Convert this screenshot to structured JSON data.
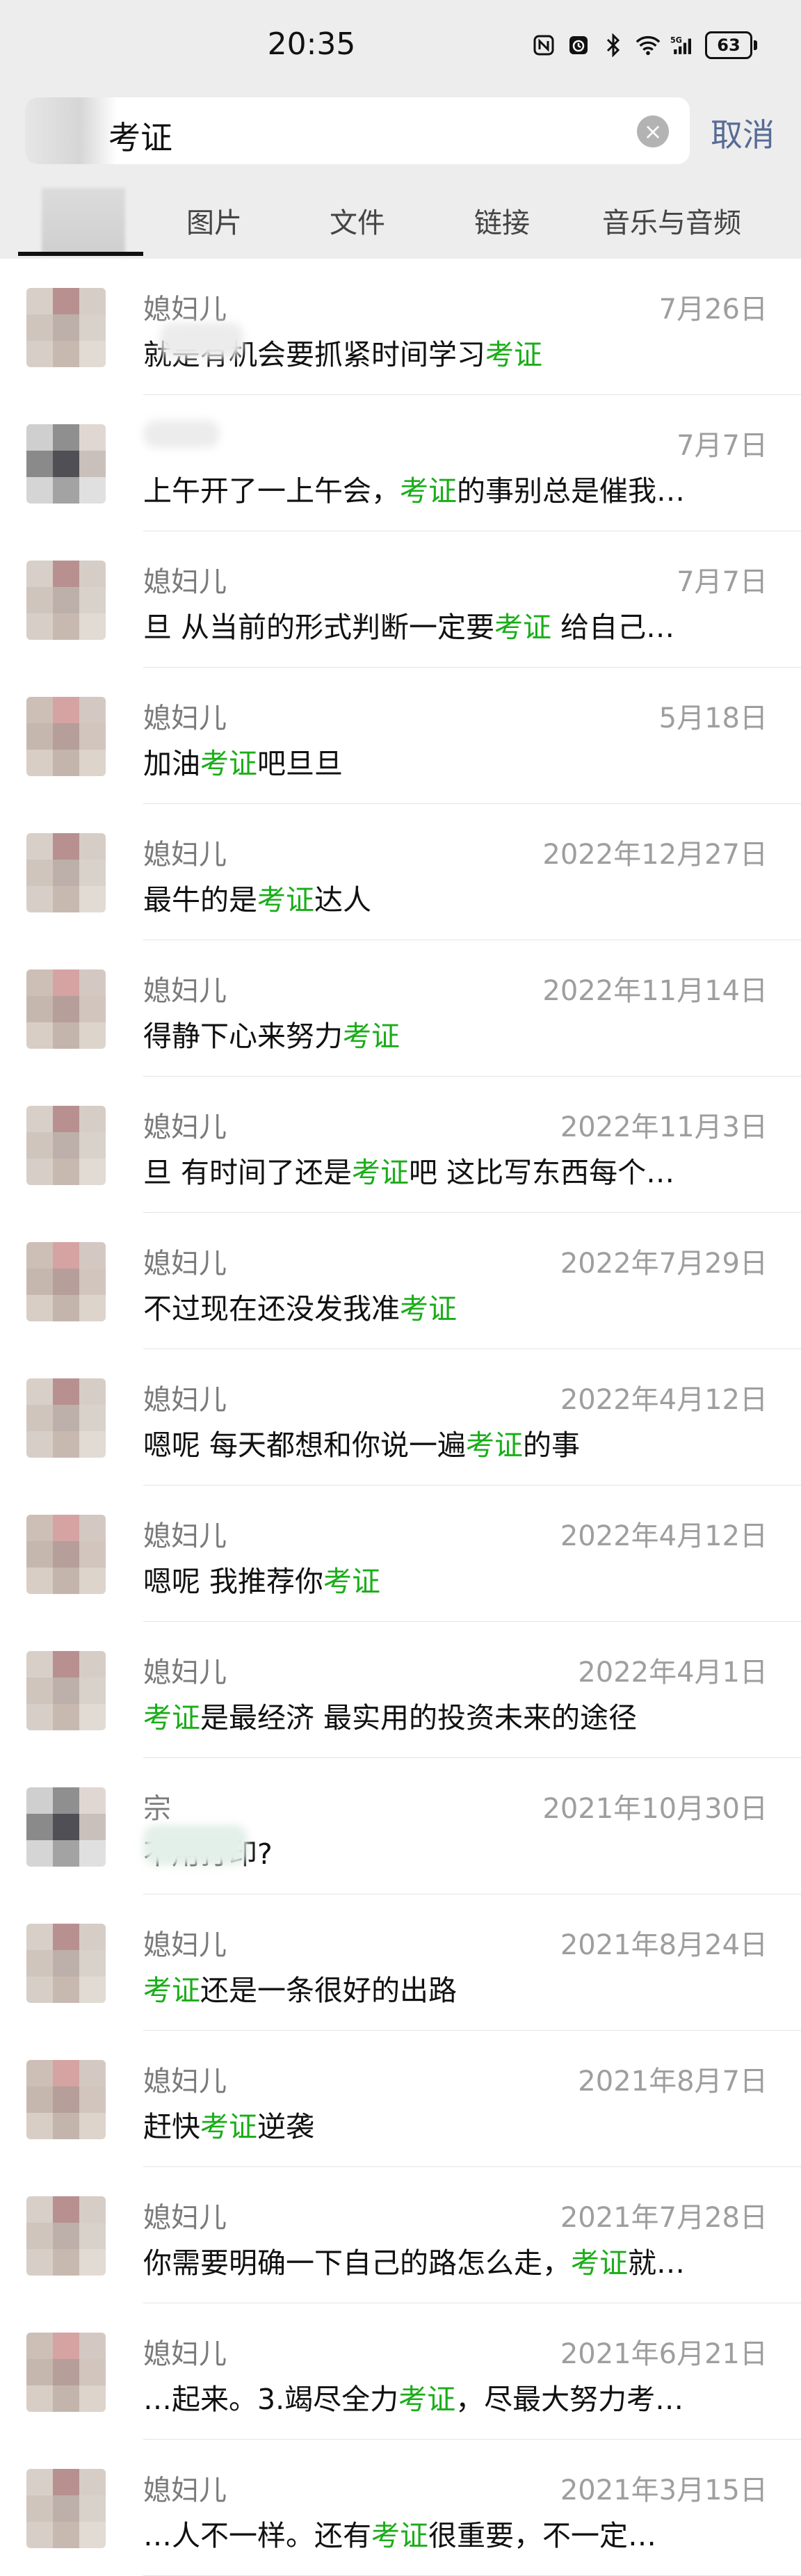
{
  "status_bar": {
    "time": "20:35",
    "battery": "63"
  },
  "search": {
    "query": "考证",
    "cancel_label": "取消"
  },
  "tabs": [
    {
      "label": "图片"
    },
    {
      "label": "文件"
    },
    {
      "label": "链接"
    },
    {
      "label": "音乐与音频"
    }
  ],
  "highlight_color": "#1aad19",
  "results": [
    {
      "name": "媳妇儿",
      "date": "7月26日",
      "pre": "就是有机会要抓紧时间学习",
      "hl": "考证",
      "post": ""
    },
    {
      "name": "",
      "date": "7月7日",
      "pre": "上午开了一上午会，",
      "hl": "考证",
      "post": "的事别总是催我…"
    },
    {
      "name": "媳妇儿",
      "date": "7月7日",
      "pre": "旦  从当前的形式判断一定要",
      "hl": "考证",
      "post": "  给自己…"
    },
    {
      "name": "媳妇儿",
      "date": "5月18日",
      "pre": "加油",
      "hl": "考证",
      "post": "吧旦旦"
    },
    {
      "name": "媳妇儿",
      "date": "2022年12月27日",
      "pre": "最牛的是",
      "hl": "考证",
      "post": "达人"
    },
    {
      "name": "媳妇儿",
      "date": "2022年11月14日",
      "pre": "得静下心来努力",
      "hl": "考证",
      "post": ""
    },
    {
      "name": "媳妇儿",
      "date": "2022年11月3日",
      "pre": "旦  有时间了还是",
      "hl": "考证",
      "post": "吧    这比写东西每个…"
    },
    {
      "name": "媳妇儿",
      "date": "2022年7月29日",
      "pre": "不过现在还没发我准",
      "hl": "考证",
      "post": ""
    },
    {
      "name": "媳妇儿",
      "date": "2022年4月12日",
      "pre": "嗯呢   每天都想和你说一遍",
      "hl": "考证",
      "post": "的事"
    },
    {
      "name": "媳妇儿",
      "date": "2022年4月12日",
      "pre": "嗯呢   我推荐你",
      "hl": "考证",
      "post": ""
    },
    {
      "name": "媳妇儿",
      "date": "2022年4月1日",
      "pre": "",
      "hl": "考证",
      "post": "是最经济 最实用的投资未来的途径"
    },
    {
      "name": "宗",
      "date": "2021年10月30日",
      "pre": "   不用打印?",
      "hl": "",
      "post": ""
    },
    {
      "name": "媳妇儿",
      "date": "2021年8月24日",
      "pre": "",
      "hl": "考证",
      "post": "还是一条很好的出路"
    },
    {
      "name": "媳妇儿",
      "date": "2021年8月7日",
      "pre": "赶快",
      "hl": "考证",
      "post": "逆袭"
    },
    {
      "name": "媳妇儿",
      "date": "2021年7月28日",
      "pre": "你需要明确一下自己的路怎么走，",
      "hl": "考证",
      "post": "就…"
    },
    {
      "name": "媳妇儿",
      "date": "2021年6月21日",
      "pre": "…起来。3.竭尽全力",
      "hl": "考证",
      "post": "，尽最大努力考…"
    },
    {
      "name": "媳妇儿",
      "date": "2021年3月15日",
      "pre": "…人不一样。还有",
      "hl": "考证",
      "post": "很重要，不一定…"
    }
  ]
}
